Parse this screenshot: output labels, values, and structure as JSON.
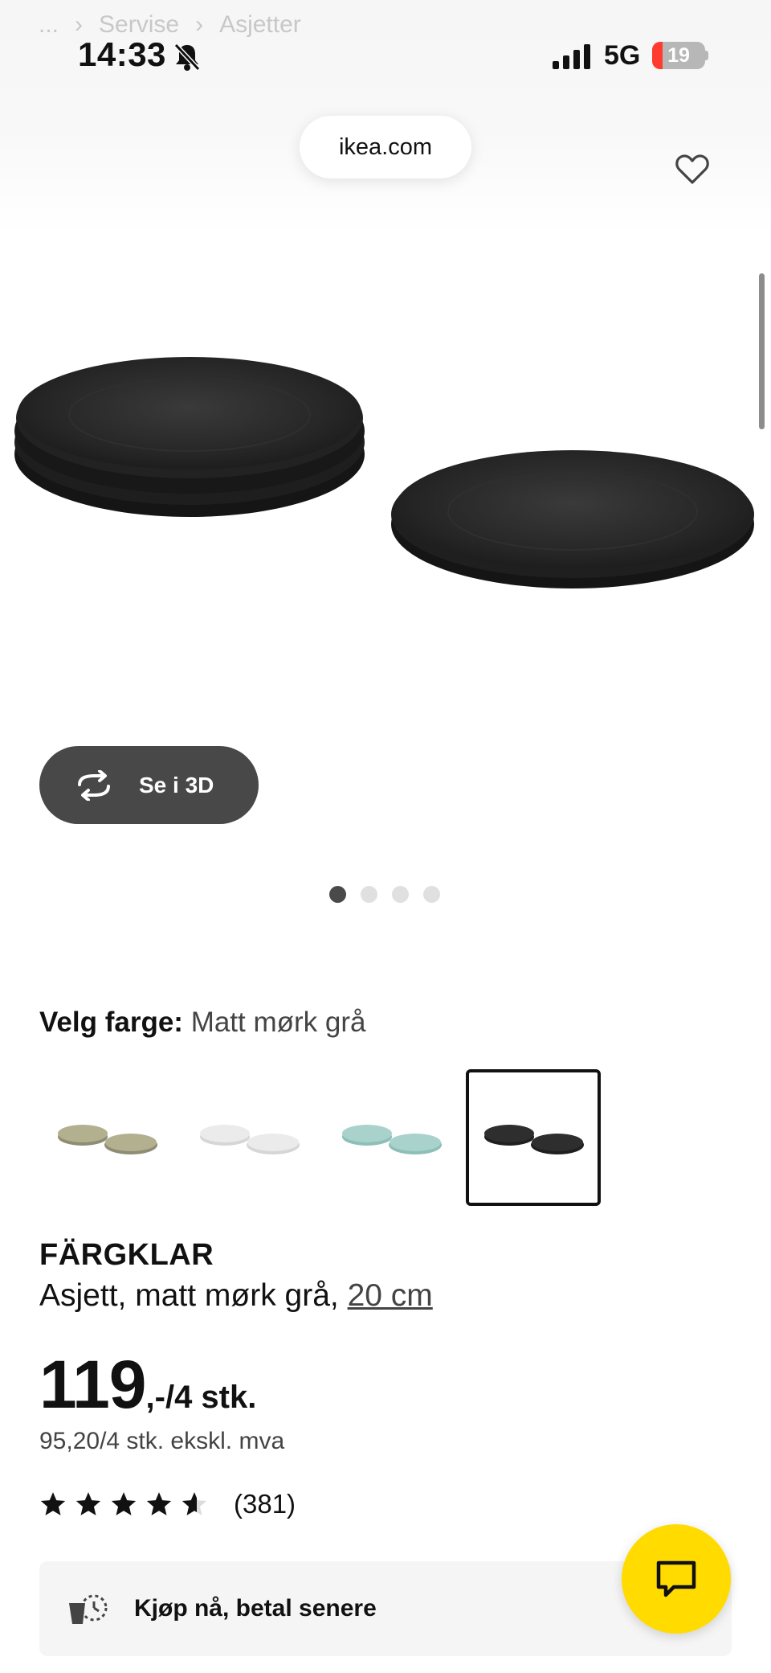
{
  "breadcrumb": {
    "items": [
      "...",
      "Servise",
      "Asjetter"
    ]
  },
  "status_bar": {
    "time": "14:33",
    "network": "5G",
    "battery_level": "19",
    "battery_fraction": 0.19
  },
  "browser": {
    "url": "ikea.com"
  },
  "gallery": {
    "view_3d_label": "Se i 3D",
    "current_image": 1,
    "image_count": 4
  },
  "color_picker": {
    "heading_label": "Velg farge:",
    "selected_value": "Matt mørk grå",
    "options": [
      {
        "name": "olive",
        "color": "#8f8c75",
        "color_light": "#b3b08f"
      },
      {
        "name": "light-grey",
        "color": "#d6d6d6",
        "color_light": "#ebebeb"
      },
      {
        "name": "turquoise",
        "color": "#8dbfb8",
        "color_light": "#a9d2cc"
      },
      {
        "name": "matt-dark-grey",
        "color": "#1f1f1f",
        "color_light": "#2e2e2e",
        "selected": true
      }
    ]
  },
  "product": {
    "name": "FÄRGKLAR",
    "description": "Asjett, matt mørk grå,",
    "size": "20 cm",
    "price_main": "119",
    "price_suffix": ",-/4 stk.",
    "price_ex_vat": "95,20/4 stk. ekskl. mva",
    "rating": 4.6,
    "rating_max": 5,
    "review_count": "(381)"
  },
  "bnpl": {
    "label": "Kjøp nå, betal senere"
  },
  "icons": {
    "favorite": "heart-outline-icon",
    "view_3d": "rotate-arrows-icon",
    "chat": "chat-bubble-icon",
    "bnpl": "basket-clock-icon",
    "bell": "bell-off-icon",
    "signal": "signal-bars-icon"
  },
  "colors": {
    "chat_button": "#ffdb00",
    "dark_button": "#484848",
    "battery_low": "#ff3b30"
  }
}
